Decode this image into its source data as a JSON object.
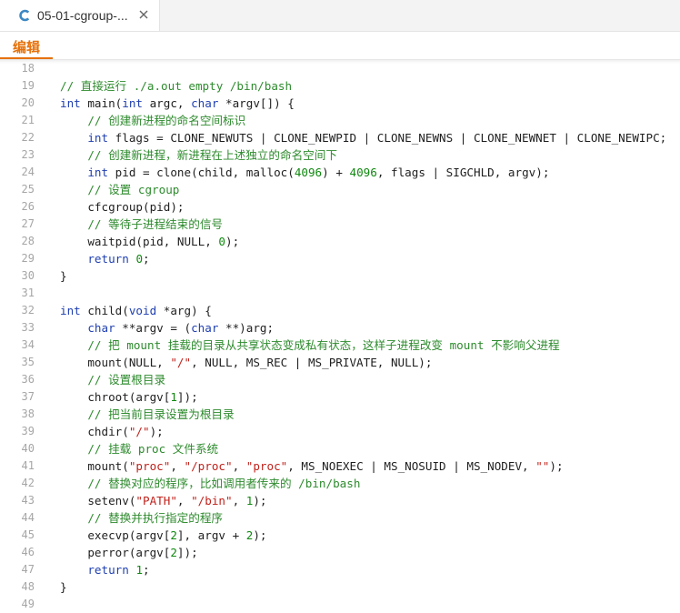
{
  "tab": {
    "title": "05-01-cgroup-...",
    "icon": "c-language-icon",
    "accent": "#3b88c3"
  },
  "toolbar": {
    "mode_label": "编辑",
    "accent": "#e5720c"
  },
  "editor": {
    "first_line": 18,
    "lines": [
      {
        "n": "18",
        "t": []
      },
      {
        "n": "19",
        "t": [
          {
            "c": "cm",
            "v": "// 直接运行 ./a.out empty /bin/bash"
          }
        ]
      },
      {
        "n": "20",
        "t": [
          {
            "c": "kw",
            "v": "int"
          },
          {
            "c": "",
            "v": " main("
          },
          {
            "c": "kw",
            "v": "int"
          },
          {
            "c": "",
            "v": " argc, "
          },
          {
            "c": "kw",
            "v": "char"
          },
          {
            "c": "",
            "v": " *argv[]) {"
          }
        ]
      },
      {
        "n": "21",
        "t": [
          {
            "c": "",
            "v": "    "
          },
          {
            "c": "cm",
            "v": "// 创建新进程的命名空间标识"
          }
        ]
      },
      {
        "n": "22",
        "t": [
          {
            "c": "",
            "v": "    "
          },
          {
            "c": "kw",
            "v": "int"
          },
          {
            "c": "",
            "v": " flags = CLONE_NEWUTS | CLONE_NEWPID | CLONE_NEWNS | CLONE_NEWNET | CLONE_NEWIPC;"
          }
        ]
      },
      {
        "n": "23",
        "t": [
          {
            "c": "",
            "v": "    "
          },
          {
            "c": "cm",
            "v": "// 创建新进程，新进程在上述独立的命名空间下"
          }
        ]
      },
      {
        "n": "24",
        "t": [
          {
            "c": "",
            "v": "    "
          },
          {
            "c": "kw",
            "v": "int"
          },
          {
            "c": "",
            "v": " pid = clone(child, malloc("
          },
          {
            "c": "num",
            "v": "4096"
          },
          {
            "c": "",
            "v": ") + "
          },
          {
            "c": "num",
            "v": "4096"
          },
          {
            "c": "",
            "v": ", flags | SIGCHLD, argv);"
          }
        ]
      },
      {
        "n": "25",
        "t": [
          {
            "c": "",
            "v": "    "
          },
          {
            "c": "cm",
            "v": "// 设置 cgroup"
          }
        ]
      },
      {
        "n": "26",
        "t": [
          {
            "c": "",
            "v": "    cfcgroup(pid);"
          }
        ]
      },
      {
        "n": "27",
        "t": [
          {
            "c": "",
            "v": "    "
          },
          {
            "c": "cm",
            "v": "// 等待子进程结束的信号"
          }
        ]
      },
      {
        "n": "28",
        "t": [
          {
            "c": "",
            "v": "    waitpid(pid, NULL, "
          },
          {
            "c": "num",
            "v": "0"
          },
          {
            "c": "",
            "v": ");"
          }
        ]
      },
      {
        "n": "29",
        "t": [
          {
            "c": "",
            "v": "    "
          },
          {
            "c": "kw",
            "v": "return"
          },
          {
            "c": "",
            "v": " "
          },
          {
            "c": "num",
            "v": "0"
          },
          {
            "c": "",
            "v": ";"
          }
        ]
      },
      {
        "n": "30",
        "t": [
          {
            "c": "",
            "v": "}"
          }
        ]
      },
      {
        "n": "31",
        "t": []
      },
      {
        "n": "32",
        "t": [
          {
            "c": "kw",
            "v": "int"
          },
          {
            "c": "",
            "v": " child("
          },
          {
            "c": "kw",
            "v": "void"
          },
          {
            "c": "",
            "v": " *arg) {"
          }
        ]
      },
      {
        "n": "33",
        "t": [
          {
            "c": "",
            "v": "    "
          },
          {
            "c": "kw",
            "v": "char"
          },
          {
            "c": "",
            "v": " **argv = ("
          },
          {
            "c": "kw",
            "v": "char"
          },
          {
            "c": "",
            "v": " **)arg;"
          }
        ]
      },
      {
        "n": "34",
        "t": [
          {
            "c": "",
            "v": "    "
          },
          {
            "c": "cm",
            "v": "// 把 mount 挂载的目录从共享状态变成私有状态，这样子进程改变 mount 不影响父进程"
          }
        ]
      },
      {
        "n": "35",
        "t": [
          {
            "c": "",
            "v": "    mount(NULL, "
          },
          {
            "c": "str",
            "v": "\"/\""
          },
          {
            "c": "",
            "v": ", NULL, MS_REC | MS_PRIVATE, NULL);"
          }
        ]
      },
      {
        "n": "36",
        "t": [
          {
            "c": "",
            "v": "    "
          },
          {
            "c": "cm",
            "v": "// 设置根目录"
          }
        ]
      },
      {
        "n": "37",
        "t": [
          {
            "c": "",
            "v": "    chroot(argv["
          },
          {
            "c": "num",
            "v": "1"
          },
          {
            "c": "",
            "v": "]);"
          }
        ]
      },
      {
        "n": "38",
        "t": [
          {
            "c": "",
            "v": "    "
          },
          {
            "c": "cm",
            "v": "// 把当前目录设置为根目录"
          }
        ]
      },
      {
        "n": "39",
        "t": [
          {
            "c": "",
            "v": "    chdir("
          },
          {
            "c": "str",
            "v": "\"/\""
          },
          {
            "c": "",
            "v": ");"
          }
        ]
      },
      {
        "n": "40",
        "t": [
          {
            "c": "",
            "v": "    "
          },
          {
            "c": "cm",
            "v": "// 挂载 proc 文件系统"
          }
        ]
      },
      {
        "n": "41",
        "t": [
          {
            "c": "",
            "v": "    mount("
          },
          {
            "c": "str",
            "v": "\"proc\""
          },
          {
            "c": "",
            "v": ", "
          },
          {
            "c": "str",
            "v": "\"/proc\""
          },
          {
            "c": "",
            "v": ", "
          },
          {
            "c": "str",
            "v": "\"proc\""
          },
          {
            "c": "",
            "v": ", MS_NOEXEC | MS_NOSUID | MS_NODEV, "
          },
          {
            "c": "str",
            "v": "\"\""
          },
          {
            "c": "",
            "v": ");"
          }
        ]
      },
      {
        "n": "42",
        "t": [
          {
            "c": "",
            "v": "    "
          },
          {
            "c": "cm",
            "v": "// 替换对应的程序，比如调用者传来的 /bin/bash"
          }
        ]
      },
      {
        "n": "43",
        "t": [
          {
            "c": "",
            "v": "    setenv("
          },
          {
            "c": "str",
            "v": "\"PATH\""
          },
          {
            "c": "",
            "v": ", "
          },
          {
            "c": "str",
            "v": "\"/bin\""
          },
          {
            "c": "",
            "v": ", "
          },
          {
            "c": "num",
            "v": "1"
          },
          {
            "c": "",
            "v": ");"
          }
        ]
      },
      {
        "n": "44",
        "t": [
          {
            "c": "",
            "v": "    "
          },
          {
            "c": "cm",
            "v": "// 替换并执行指定的程序"
          }
        ]
      },
      {
        "n": "45",
        "t": [
          {
            "c": "",
            "v": "    execvp(argv["
          },
          {
            "c": "num",
            "v": "2"
          },
          {
            "c": "",
            "v": "], argv + "
          },
          {
            "c": "num",
            "v": "2"
          },
          {
            "c": "",
            "v": ");"
          }
        ]
      },
      {
        "n": "46",
        "t": [
          {
            "c": "",
            "v": "    perror(argv["
          },
          {
            "c": "num",
            "v": "2"
          },
          {
            "c": "",
            "v": "]);"
          }
        ]
      },
      {
        "n": "47",
        "t": [
          {
            "c": "",
            "v": "    "
          },
          {
            "c": "kw",
            "v": "return"
          },
          {
            "c": "",
            "v": " "
          },
          {
            "c": "num",
            "v": "1"
          },
          {
            "c": "",
            "v": ";"
          }
        ]
      },
      {
        "n": "48",
        "t": [
          {
            "c": "",
            "v": "}"
          }
        ]
      },
      {
        "n": "49",
        "t": []
      }
    ]
  },
  "colors": {
    "keyword": "#1f3fb0",
    "number": "#118811",
    "string": "#c0221b",
    "comment": "#2e8b2e",
    "line_number": "#a6a6a6"
  }
}
